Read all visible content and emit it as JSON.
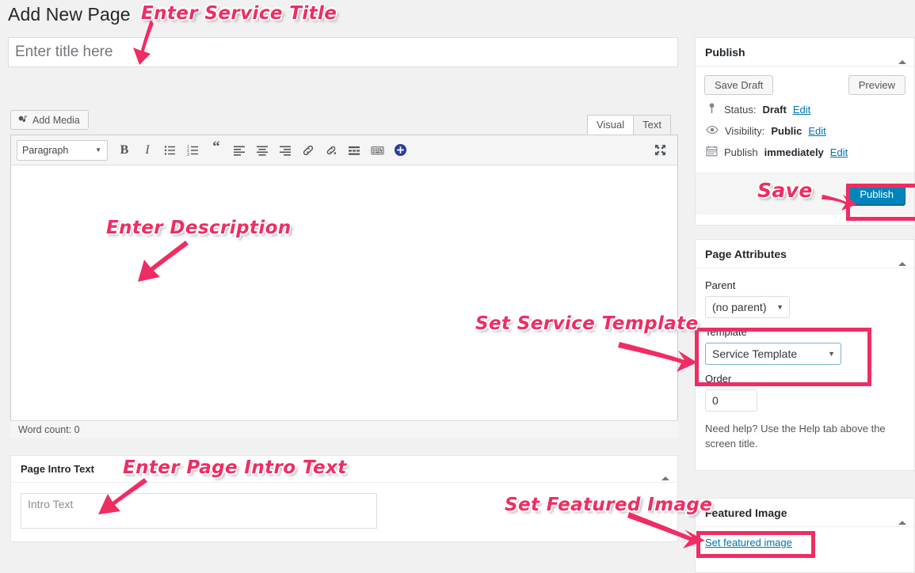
{
  "page": {
    "heading": "Add New Page"
  },
  "title_field": {
    "placeholder": "Enter title here",
    "value": ""
  },
  "editor": {
    "add_media_label": "Add Media",
    "tabs": [
      {
        "label": "Visual",
        "active": true
      },
      {
        "label": "Text",
        "active": false
      }
    ],
    "format_select": {
      "value": "Paragraph",
      "caret": "▼"
    },
    "toolbar_icons": [
      "bold-icon",
      "italic-icon",
      "bulleted-list-icon",
      "numbered-list-icon",
      "blockquote-icon",
      "align-left-icon",
      "align-center-icon",
      "align-right-icon",
      "insert-link-icon",
      "remove-link-icon",
      "insert-read-more-icon",
      "keyboard-shortcuts-icon",
      "toolbar-toggle-icon",
      "fullscreen-icon"
    ],
    "content": "",
    "word_count": "Word count: 0"
  },
  "intro_metabox": {
    "title": "Page Intro Text",
    "toggle_icon": "collapse-arrow-icon",
    "textarea": {
      "placeholder": "Intro Text",
      "value": ""
    }
  },
  "publish_panel": {
    "title": "Publish",
    "toggle_icon": "collapse-arrow-icon",
    "save_draft_label": "Save Draft",
    "preview_label": "Preview",
    "status": {
      "icon": "pin-icon",
      "label": "Status:",
      "value": "Draft",
      "edit_label": "Edit"
    },
    "visibility": {
      "icon": "eye-icon",
      "label": "Visibility:",
      "value": "Public",
      "edit_label": "Edit"
    },
    "schedule": {
      "icon": "calendar-icon",
      "label": "Publish",
      "value": "immediately",
      "edit_label": "Edit"
    },
    "publish_label": "Publish"
  },
  "page_attributes": {
    "title": "Page Attributes",
    "toggle_icon": "collapse-arrow-icon",
    "parent": {
      "label": "Parent",
      "value": "(no parent)",
      "caret": "▼"
    },
    "template": {
      "label": "Template",
      "value": "Service Template",
      "caret": "▼"
    },
    "order": {
      "label": "Order",
      "value": "0"
    },
    "help_text": "Need help? Use the Help tab above the screen title."
  },
  "featured_image": {
    "title": "Featured Image",
    "toggle_icon": "collapse-arrow-icon",
    "set_link_label": "Set featured image"
  },
  "annotations": [
    {
      "id": "title",
      "text": "Enter Service Title"
    },
    {
      "id": "desc",
      "text": "Enter Description"
    },
    {
      "id": "template",
      "text": "Set Service Template"
    },
    {
      "id": "save",
      "text": "Save"
    },
    {
      "id": "intro",
      "text": "Enter Page Intro Text"
    },
    {
      "id": "featured",
      "text": "Set Featured Image"
    }
  ],
  "colors": {
    "annotation": "#ef2d63",
    "publish_button": "#0085ba",
    "link": "#0073aa",
    "page_background": "#f1f1f1"
  }
}
